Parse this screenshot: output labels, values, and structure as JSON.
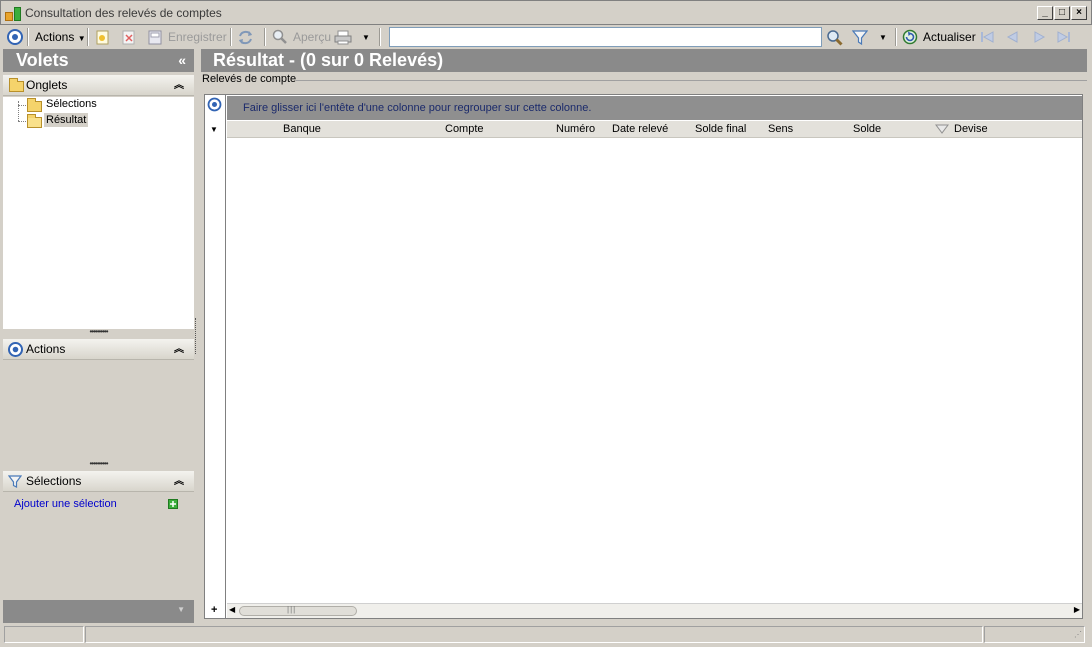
{
  "window": {
    "title": "Consultation des relevés de comptes",
    "controls": {
      "minimize": "_",
      "maximize": "□",
      "close": "×"
    }
  },
  "toolbar": {
    "actions_label": "Actions",
    "save_label": "Enregistrer",
    "preview_label": "Aperçu",
    "search_value": "",
    "refresh_label": "Actualiser"
  },
  "left_panel": {
    "title": "Volets",
    "collapse_glyph": "«",
    "onglets": {
      "title": "Onglets",
      "items": [
        {
          "label": "Sélections",
          "selected": false
        },
        {
          "label": "Résultat",
          "selected": true
        }
      ]
    },
    "actions": {
      "title": "Actions"
    },
    "selections": {
      "title": "Sélections",
      "add_label": "Ajouter une sélection"
    }
  },
  "main": {
    "title": "Résultat - (0 sur 0 Relevés)",
    "group_label": "Relevés de compte",
    "group_hint": "Faire glisser ici l'entête d'une colonne pour regrouper sur cette colonne.",
    "columns": [
      "Banque",
      "Compte",
      "Numéro",
      "Date relevé",
      "Solde final",
      "Sens",
      "Solde",
      "Devise"
    ],
    "rows": []
  },
  "colors": {
    "panel_header": "#8a8a8a",
    "window_bg": "#d4d0c8",
    "group_text": "#1b2a6b",
    "link": "#0000cc"
  }
}
